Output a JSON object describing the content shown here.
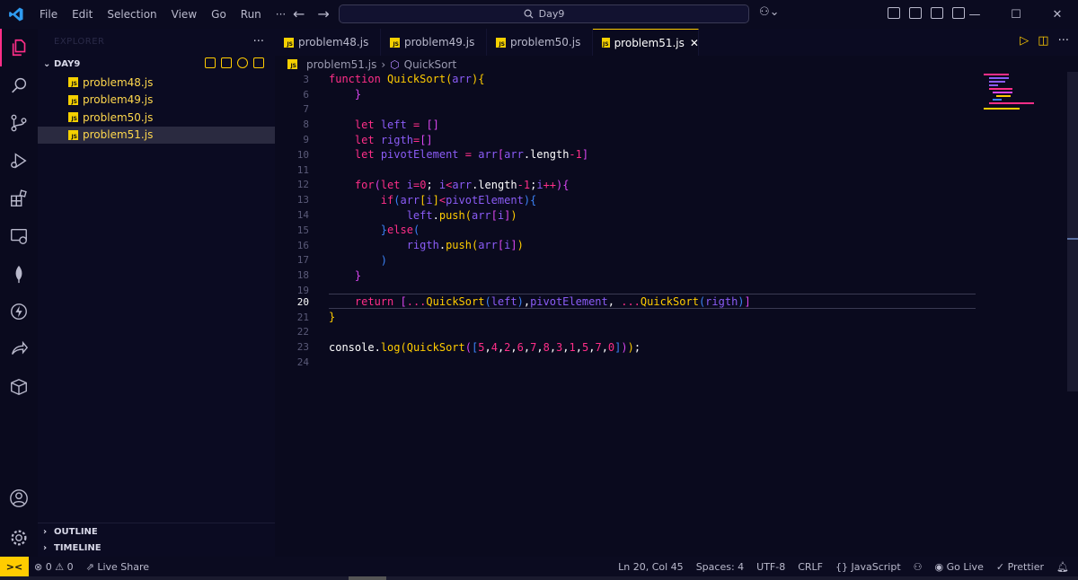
{
  "menu": [
    "File",
    "Edit",
    "Selection",
    "View",
    "Go",
    "Run",
    "···"
  ],
  "search": {
    "text": "Day9"
  },
  "colors": {
    "accent": "#ffcc00",
    "keyword": "#ff2e88",
    "bg": "#0a0a1e"
  },
  "sidebar": {
    "header": "EXPLORER",
    "folder": "DAY9",
    "files": [
      "problem48.js",
      "problem49.js",
      "problem50.js",
      "problem51.js"
    ],
    "selected": "problem51.js",
    "outline": "OUTLINE",
    "timeline": "TIMELINE"
  },
  "tabs": [
    {
      "label": "problem48.js"
    },
    {
      "label": "problem49.js"
    },
    {
      "label": "problem50.js"
    },
    {
      "label": "problem51.js",
      "active": true
    }
  ],
  "breadcrumb": {
    "file": "problem51.js",
    "symbol": "QuickSort"
  },
  "editor": {
    "current_line": 20,
    "line_numbers": [
      "3",
      "6",
      "7",
      "8",
      "9",
      "10",
      "11",
      "12",
      "13",
      "14",
      "15",
      "16",
      "17",
      "18",
      "19",
      "20",
      "21",
      "22",
      "23",
      "24"
    ]
  },
  "status": {
    "problems_errors": "0",
    "problems_warnings": "0",
    "live_share": "Live Share",
    "position": "Ln 20, Col 45",
    "spaces": "Spaces: 4",
    "encoding": "UTF-8",
    "eol": "CRLF",
    "language": "JavaScript",
    "golive": "Go Live",
    "prettier": "Prettier"
  }
}
